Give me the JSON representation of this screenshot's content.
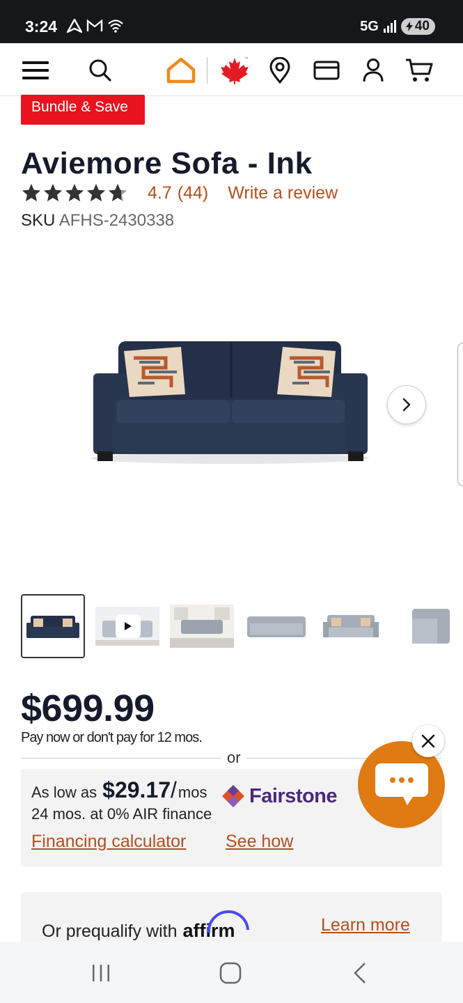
{
  "status_bar": {
    "time": "3:24",
    "network": "5G",
    "battery": "40"
  },
  "header": {
    "icons": [
      "menu-icon",
      "search-icon",
      "home-logo-icon",
      "maple-leaf-icon",
      "location-pin-icon",
      "credit-card-icon",
      "account-icon",
      "cart-icon"
    ],
    "tm": "™"
  },
  "promo_badge": "Bundle & Save",
  "product": {
    "title": "Aviemore Sofa - Ink",
    "rating": 4.7,
    "rating_text": "4.7",
    "review_count": "(44)",
    "write_review": "Write a review",
    "sku_label": "SKU",
    "sku_value": "AFHS-2430338",
    "gallery_count": 6,
    "selected_thumb": 0
  },
  "pricing": {
    "price": "$699.99",
    "pay_note": "Pay now or don't pay for 12 mos.",
    "or": "or"
  },
  "financing": {
    "as_low_as": "As low as",
    "amount": "$29.17",
    "slash": "/",
    "per": "mos",
    "terms": "24 mos. at 0% AIR finance",
    "provider": "Fairstone",
    "calculator_link": "Financing calculator",
    "see_how_link": "See how"
  },
  "affirm": {
    "text": "Or prequalify with",
    "logo": "affirm",
    "learn_more": "Learn more"
  },
  "colors": {
    "accent_orange": "#b0501f",
    "badge_red": "#e8131f",
    "chat_orange": "#e07a12",
    "navy": "#151b2b"
  }
}
